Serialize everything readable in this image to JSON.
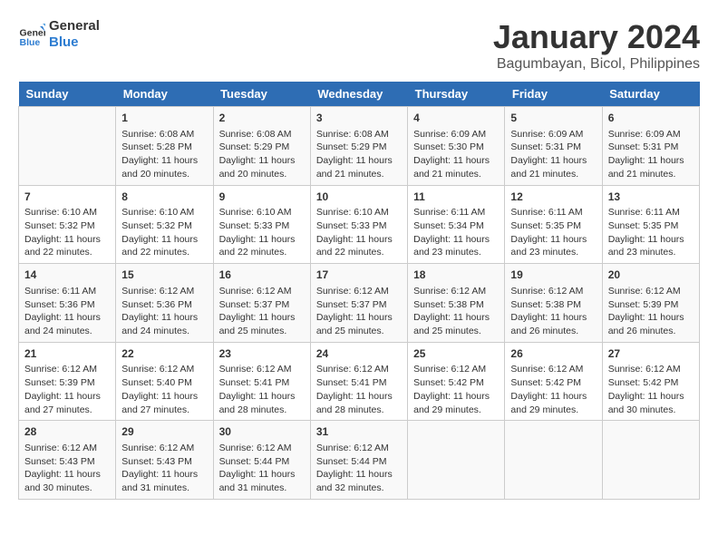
{
  "logo": {
    "text_general": "General",
    "text_blue": "Blue"
  },
  "title": "January 2024",
  "subtitle": "Bagumbayan, Bicol, Philippines",
  "days_header": [
    "Sunday",
    "Monday",
    "Tuesday",
    "Wednesday",
    "Thursday",
    "Friday",
    "Saturday"
  ],
  "weeks": [
    [
      {
        "num": "",
        "text": ""
      },
      {
        "num": "1",
        "text": "Sunrise: 6:08 AM\nSunset: 5:28 PM\nDaylight: 11 hours\nand 20 minutes."
      },
      {
        "num": "2",
        "text": "Sunrise: 6:08 AM\nSunset: 5:29 PM\nDaylight: 11 hours\nand 20 minutes."
      },
      {
        "num": "3",
        "text": "Sunrise: 6:08 AM\nSunset: 5:29 PM\nDaylight: 11 hours\nand 21 minutes."
      },
      {
        "num": "4",
        "text": "Sunrise: 6:09 AM\nSunset: 5:30 PM\nDaylight: 11 hours\nand 21 minutes."
      },
      {
        "num": "5",
        "text": "Sunrise: 6:09 AM\nSunset: 5:31 PM\nDaylight: 11 hours\nand 21 minutes."
      },
      {
        "num": "6",
        "text": "Sunrise: 6:09 AM\nSunset: 5:31 PM\nDaylight: 11 hours\nand 21 minutes."
      }
    ],
    [
      {
        "num": "7",
        "text": "Sunrise: 6:10 AM\nSunset: 5:32 PM\nDaylight: 11 hours\nand 22 minutes."
      },
      {
        "num": "8",
        "text": "Sunrise: 6:10 AM\nSunset: 5:32 PM\nDaylight: 11 hours\nand 22 minutes."
      },
      {
        "num": "9",
        "text": "Sunrise: 6:10 AM\nSunset: 5:33 PM\nDaylight: 11 hours\nand 22 minutes."
      },
      {
        "num": "10",
        "text": "Sunrise: 6:10 AM\nSunset: 5:33 PM\nDaylight: 11 hours\nand 22 minutes."
      },
      {
        "num": "11",
        "text": "Sunrise: 6:11 AM\nSunset: 5:34 PM\nDaylight: 11 hours\nand 23 minutes."
      },
      {
        "num": "12",
        "text": "Sunrise: 6:11 AM\nSunset: 5:35 PM\nDaylight: 11 hours\nand 23 minutes."
      },
      {
        "num": "13",
        "text": "Sunrise: 6:11 AM\nSunset: 5:35 PM\nDaylight: 11 hours\nand 23 minutes."
      }
    ],
    [
      {
        "num": "14",
        "text": "Sunrise: 6:11 AM\nSunset: 5:36 PM\nDaylight: 11 hours\nand 24 minutes."
      },
      {
        "num": "15",
        "text": "Sunrise: 6:12 AM\nSunset: 5:36 PM\nDaylight: 11 hours\nand 24 minutes."
      },
      {
        "num": "16",
        "text": "Sunrise: 6:12 AM\nSunset: 5:37 PM\nDaylight: 11 hours\nand 25 minutes."
      },
      {
        "num": "17",
        "text": "Sunrise: 6:12 AM\nSunset: 5:37 PM\nDaylight: 11 hours\nand 25 minutes."
      },
      {
        "num": "18",
        "text": "Sunrise: 6:12 AM\nSunset: 5:38 PM\nDaylight: 11 hours\nand 25 minutes."
      },
      {
        "num": "19",
        "text": "Sunrise: 6:12 AM\nSunset: 5:38 PM\nDaylight: 11 hours\nand 26 minutes."
      },
      {
        "num": "20",
        "text": "Sunrise: 6:12 AM\nSunset: 5:39 PM\nDaylight: 11 hours\nand 26 minutes."
      }
    ],
    [
      {
        "num": "21",
        "text": "Sunrise: 6:12 AM\nSunset: 5:39 PM\nDaylight: 11 hours\nand 27 minutes."
      },
      {
        "num": "22",
        "text": "Sunrise: 6:12 AM\nSunset: 5:40 PM\nDaylight: 11 hours\nand 27 minutes."
      },
      {
        "num": "23",
        "text": "Sunrise: 6:12 AM\nSunset: 5:41 PM\nDaylight: 11 hours\nand 28 minutes."
      },
      {
        "num": "24",
        "text": "Sunrise: 6:12 AM\nSunset: 5:41 PM\nDaylight: 11 hours\nand 28 minutes."
      },
      {
        "num": "25",
        "text": "Sunrise: 6:12 AM\nSunset: 5:42 PM\nDaylight: 11 hours\nand 29 minutes."
      },
      {
        "num": "26",
        "text": "Sunrise: 6:12 AM\nSunset: 5:42 PM\nDaylight: 11 hours\nand 29 minutes."
      },
      {
        "num": "27",
        "text": "Sunrise: 6:12 AM\nSunset: 5:42 PM\nDaylight: 11 hours\nand 30 minutes."
      }
    ],
    [
      {
        "num": "28",
        "text": "Sunrise: 6:12 AM\nSunset: 5:43 PM\nDaylight: 11 hours\nand 30 minutes."
      },
      {
        "num": "29",
        "text": "Sunrise: 6:12 AM\nSunset: 5:43 PM\nDaylight: 11 hours\nand 31 minutes."
      },
      {
        "num": "30",
        "text": "Sunrise: 6:12 AM\nSunset: 5:44 PM\nDaylight: 11 hours\nand 31 minutes."
      },
      {
        "num": "31",
        "text": "Sunrise: 6:12 AM\nSunset: 5:44 PM\nDaylight: 11 hours\nand 32 minutes."
      },
      {
        "num": "",
        "text": ""
      },
      {
        "num": "",
        "text": ""
      },
      {
        "num": "",
        "text": ""
      }
    ]
  ]
}
